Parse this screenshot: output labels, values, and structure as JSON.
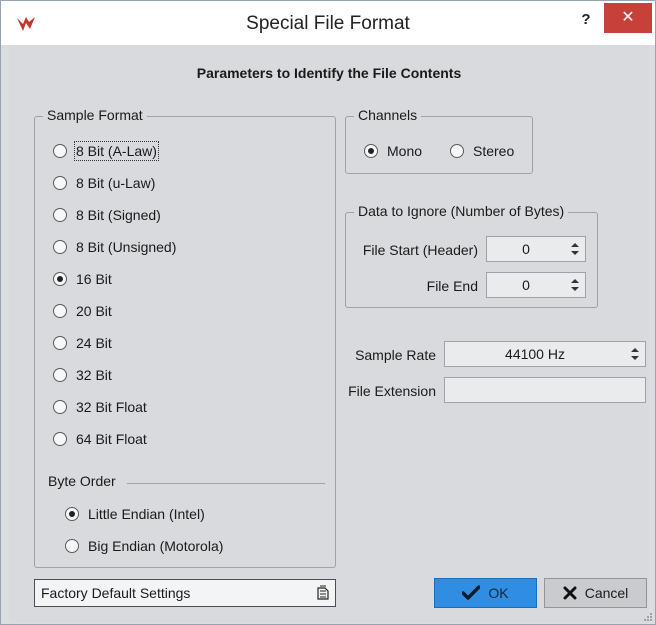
{
  "window": {
    "title": "Special File Format",
    "help_label": "?",
    "close_label": "✕"
  },
  "heading": "Parameters to Identify the File Contents",
  "sample_format": {
    "legend": "Sample Format",
    "options": [
      {
        "label": "8 Bit (A-Law)",
        "checked": false
      },
      {
        "label": "8 Bit (u-Law)",
        "checked": false
      },
      {
        "label": "8 Bit (Signed)",
        "checked": false
      },
      {
        "label": "8 Bit (Unsigned)",
        "checked": false
      },
      {
        "label": "16 Bit",
        "checked": true
      },
      {
        "label": "20 Bit",
        "checked": false
      },
      {
        "label": "24 Bit",
        "checked": false
      },
      {
        "label": "32 Bit",
        "checked": false
      },
      {
        "label": "32 Bit Float",
        "checked": false
      },
      {
        "label": "64 Bit Float",
        "checked": false
      }
    ]
  },
  "byte_order": {
    "label": "Byte Order",
    "options": [
      {
        "label": "Little Endian (Intel)",
        "checked": true
      },
      {
        "label": "Big Endian (Motorola)",
        "checked": false
      }
    ]
  },
  "channels": {
    "legend": "Channels",
    "options": [
      {
        "label": "Mono",
        "checked": true
      },
      {
        "label": "Stereo",
        "checked": false
      }
    ]
  },
  "data_to_ignore": {
    "legend": "Data to Ignore (Number of Bytes)",
    "file_start_label": "File Start (Header)",
    "file_start_value": "0",
    "file_end_label": "File End",
    "file_end_value": "0"
  },
  "sample_rate": {
    "label": "Sample Rate",
    "value": "44100 Hz"
  },
  "file_extension": {
    "label": "File Extension",
    "value": ""
  },
  "presets": {
    "label": "Factory Default Settings"
  },
  "buttons": {
    "ok": "OK",
    "cancel": "Cancel"
  },
  "colors": {
    "close": "#c8403a",
    "ok_button": "#2f8de4",
    "background": "#d8dadd"
  }
}
